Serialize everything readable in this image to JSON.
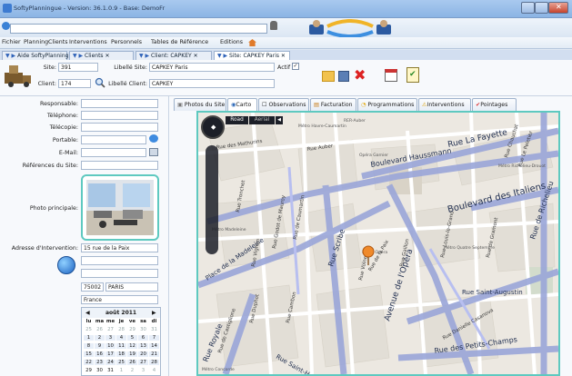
{
  "window": {
    "title": "SoftyPlanningue - Version: 36.1.0.9 - Base: DemoFr"
  },
  "menu": [
    "Fichier",
    "Planning",
    "Clients",
    "Interventions",
    "Personnels",
    "Tables de Référence",
    "Editions"
  ],
  "doc_tabs": [
    "Aide SoftyPlanning",
    "Clients",
    "Client: CAPKEY",
    "Site: CAPKEY Paris"
  ],
  "header": {
    "site_label": "Site:",
    "site_value": "391",
    "libelle_site_label": "Libellé Site:",
    "libelle_site_value": "CAPKEY Paris",
    "actif_label": "Actif",
    "client_label": "Client:",
    "client_value": "174",
    "libelle_client_label": "Libellé Client:",
    "libelle_client_value": "CAPKEY"
  },
  "form": {
    "responsable": "Responsable:",
    "telephone": "Téléphone:",
    "telecopie": "Télécopie:",
    "portable": "Portable:",
    "email": "E-Mail:",
    "references": "Références du Site:",
    "photo": "Photo principale:",
    "adresse_label": "Adresse d'Intervention:",
    "adresse_value": "15 rue de la Paix",
    "cp": "75002",
    "ville": "PARIS",
    "pays": "France"
  },
  "calendar": {
    "month": "août 2011",
    "days": [
      "lu",
      "ma",
      "me",
      "je",
      "ve",
      "sa",
      "di"
    ],
    "rows": [
      [
        "25",
        "26",
        "27",
        "28",
        "29",
        "30",
        "31"
      ],
      [
        "1",
        "2",
        "3",
        "4",
        "5",
        "6",
        "7"
      ],
      [
        "8",
        "9",
        "10",
        "11",
        "12",
        "13",
        "14"
      ],
      [
        "15",
        "16",
        "17",
        "18",
        "19",
        "20",
        "21"
      ],
      [
        "22",
        "23",
        "24",
        "25",
        "26",
        "27",
        "28"
      ],
      [
        "29",
        "30",
        "31",
        "1",
        "2",
        "3",
        "4"
      ]
    ]
  },
  "sub_tabs": [
    "Photos du Site",
    "Carto",
    "Observations",
    "Facturation",
    "Programmations",
    "Interventions",
    "Pointages"
  ],
  "map": {
    "btn_road": "Road",
    "btn_aerial": "Aerial",
    "streets": [
      "Rue La Fayette",
      "Boulevard Haussmann",
      "Boulevard des Italiens",
      "Rue de Richelieu",
      "Rue Scribe",
      "Avenue de l'Opéra",
      "Rue de la Paix",
      "Rue Saint-Augustin",
      "Rue des Petits-Champs",
      "Rue Royale",
      "Rue Saint-Honoré",
      "Place de la Madeleine",
      "Rue Tronchet",
      "Rue Vignon",
      "Rue Godot de Mauroy",
      "Rue de Caumartin",
      "Rue Cambon",
      "Rue Duphot",
      "Rue Volney",
      "Rue Daunou",
      "Rue des Mathurins",
      "Rue Le Peletier",
      "Rue Chauchat",
      "Rue Auber",
      "Rue de Castiglione",
      "Rue Gaillon",
      "Rue Louis-le-Grand",
      "Rue de Gramont",
      "Rue Danielle Casanova"
    ],
    "places": [
      "Métro Havre-Caumartin",
      "RER-Auber",
      "Opéra Garnier",
      "Métro Richelieu-Drouot",
      "Métro Madeleine",
      "Métro Quatre Septembre",
      "Métro Opéra",
      "Métro Concorde"
    ]
  }
}
